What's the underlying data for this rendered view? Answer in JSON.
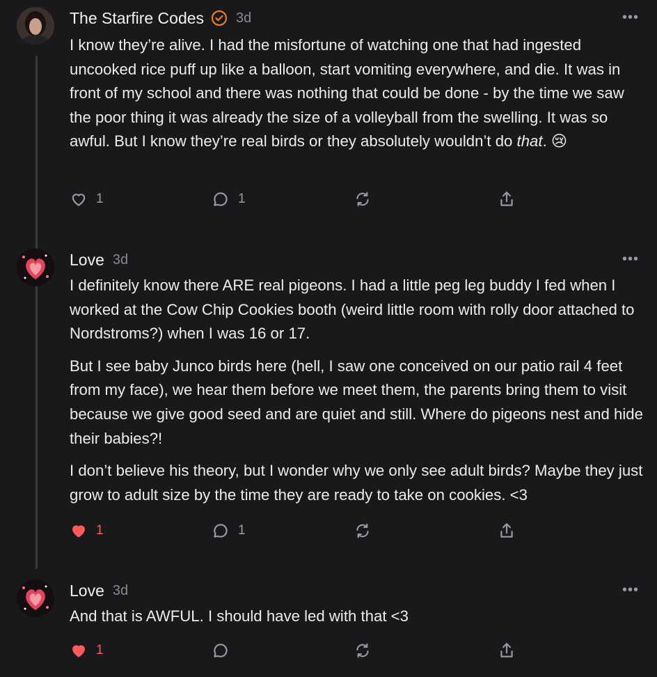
{
  "comments": [
    {
      "author": "The Starfire Codes",
      "verified": true,
      "time": "3d",
      "paragraphs": [
        "I know they’re alive. I had the misfortune of watching one that had ingested uncooked rice puff up like a balloon, start vomiting everywhere, and die. It was in front of my school and there was nothing that could be done - by the time we saw the poor thing it was already the size of a volleyball from the swelling. It was so awful. But I know they’re real birds or they absolutely wouldn’t do"
      ],
      "tail_italic": "that",
      "tail_rest": ". 😢",
      "likes": "1",
      "replies": "1",
      "liked": false
    },
    {
      "author": "Love",
      "time": "3d",
      "paragraphs": [
        "I definitely know there ARE real pigeons. I had a little peg leg buddy I fed when I worked at the Cow Chip Cookies booth (weird little room with rolly door attached to Nordstroms?) when I was 16 or 17.",
        "But I see baby Junco birds here (hell, I saw one conceived on our patio rail 4 feet from my face), we hear them before we meet them, the parents bring them to visit because we give good seed and are quiet and still. Where do pigeons nest and hide their babies?!",
        "I don’t believe his theory, but I wonder why we only see adult birds? Maybe they just grow to adult size by the time they are ready to take on cookies. <3"
      ],
      "likes": "1",
      "replies": "1",
      "liked": true
    },
    {
      "author": "Love",
      "time": "3d",
      "paragraphs": [
        "And that is AWFUL. I should have led with that <3"
      ],
      "likes": "1",
      "replies": "",
      "liked": true
    }
  ],
  "colors": {
    "background": "#19191b",
    "like_active": "#ff5a5a",
    "verified": "#f07a2a"
  },
  "icons": [
    "heart-icon",
    "comment-icon",
    "restack-icon",
    "share-icon",
    "more-icon",
    "verified-icon"
  ]
}
